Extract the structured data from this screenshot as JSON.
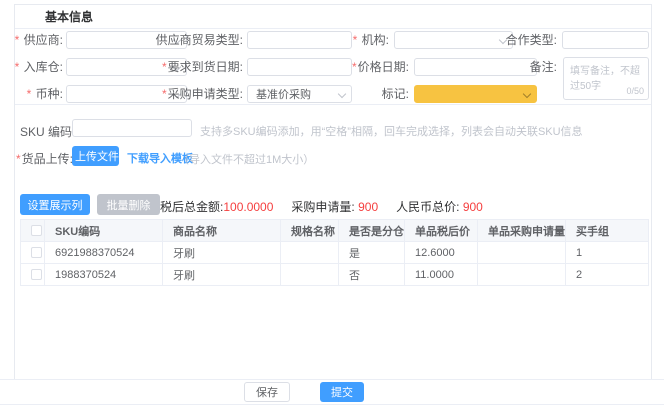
{
  "misc": {
    "required_mark": "*"
  },
  "header": {
    "title": "基本信息"
  },
  "fields": {
    "supplier": {
      "label": "供应商:"
    },
    "supplier_trade_type": {
      "label": "供应商贸易类型:"
    },
    "organization": {
      "label": "机构:"
    },
    "cooperation_type": {
      "label": "合作类型:"
    },
    "warehouse": {
      "label": "入库仓:"
    },
    "required_arrival_date": {
      "label": "要求到货日期:"
    },
    "price_date": {
      "label": "价格日期:"
    },
    "remark": {
      "label": "备注:",
      "placeholder": "填写备注，不超过50字",
      "counter": "0/50"
    },
    "currency": {
      "label": "币种:"
    },
    "purchase_request_type": {
      "label": "采购申请类型:",
      "value": "基准价采购"
    },
    "mark": {
      "label": "标记:",
      "color": "#F7C341"
    }
  },
  "sku_section": {
    "label": "SKU 编码:",
    "hint": "支持多SKU编码添加，用“空格”相隔，回车完成选择，列表会自动关联SKU信息"
  },
  "upload_section": {
    "label": "货品上传:",
    "upload_button": "上传文件",
    "download_link": "下载导入模板",
    "note": "（导入文件不超过1M大小）"
  },
  "toolbar": {
    "set_columns": "设置展示列",
    "batch_delete": "批量删除"
  },
  "summary": {
    "total_after_tax_label": "税后总金额:",
    "total_after_tax_value": "100.0000",
    "request_qty_label": "采购申请量:",
    "request_qty_value": "900",
    "cny_total_label": "人民币总价:",
    "cny_total_value": "900"
  },
  "table": {
    "columns": [
      "SKU编码",
      "商品名称",
      "规格名称",
      "是否是分仓SKU",
      "单品税后价",
      "单品采购申请量",
      "买手组"
    ],
    "rows": [
      {
        "sku_code": "6921988370524",
        "product_name": "牙刷",
        "spec_name": "",
        "is_split_sku": "是",
        "unit_price_after_tax": "12.6000",
        "unit_request_qty": "",
        "buyer_group": "1"
      },
      {
        "sku_code": "1988370524",
        "product_name": "牙刷",
        "spec_name": "",
        "is_split_sku": "否",
        "unit_price_after_tax": "11.0000",
        "unit_request_qty": "",
        "buyer_group": "2"
      }
    ]
  },
  "footer": {
    "save": "保存",
    "submit": "提交"
  },
  "colors": {
    "primary": "#409EFF",
    "required": "#F56C6C",
    "value_red": "#F53F3F",
    "mark_yellow": "#F7C341"
  }
}
